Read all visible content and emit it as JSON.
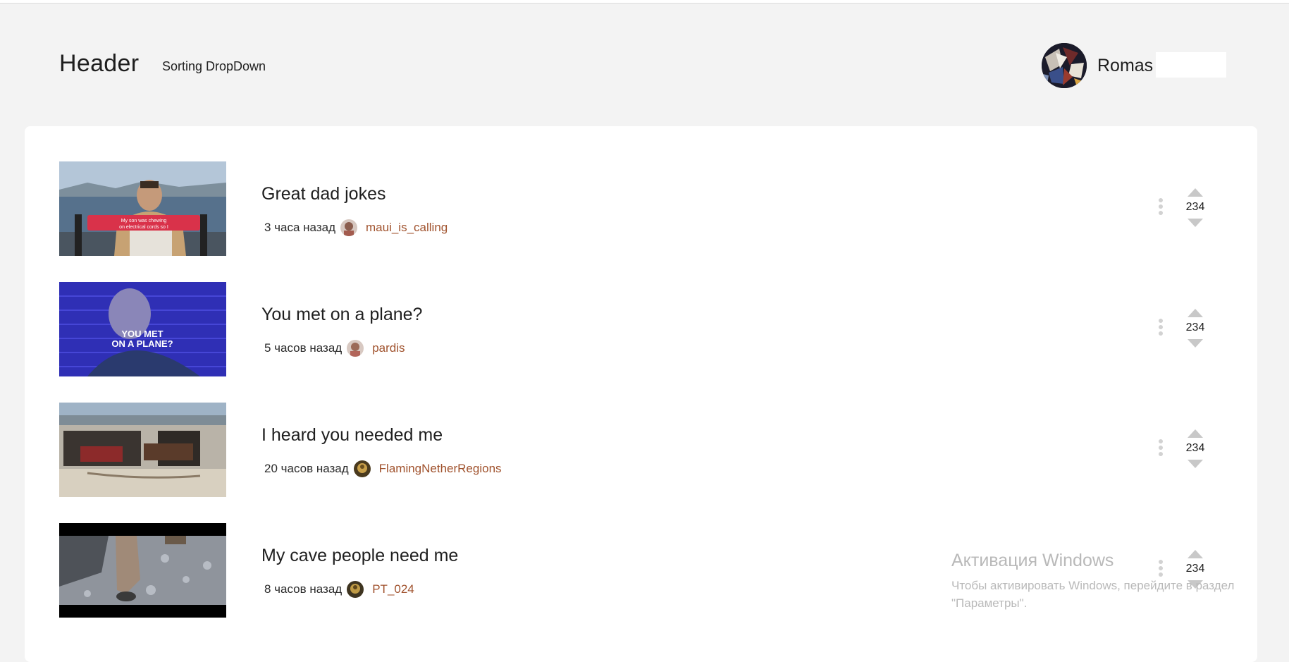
{
  "header": {
    "title": "Header",
    "sorting_label": "Sorting DropDown",
    "user": {
      "name": "Romas"
    }
  },
  "posts": [
    {
      "title": "Great dad jokes",
      "time": "3 часа назад",
      "author": "maui_is_calling",
      "votes": "234",
      "thumb_caption": "My son was chewing on electrical cords so I had to ground him"
    },
    {
      "title": "You met on a plane?",
      "time": "5 часов назад",
      "author": "pardis",
      "votes": "234",
      "thumb_caption": "YOU MET ON A PLANE?"
    },
    {
      "title": "I heard you needed me",
      "time": "20 часов назад",
      "author": "FlamingNetherRegions",
      "votes": "234"
    },
    {
      "title": "My cave people need me",
      "time": "8 часов назад",
      "author": "PT_024",
      "votes": "234"
    }
  ],
  "watermark": {
    "title": "Активация Windows",
    "line1": "Чтобы активировать Windows, перейдите в раздел",
    "line2": "\"Параметры\"."
  },
  "colors": {
    "author_link": "#a0522d",
    "background": "#f3f3f3",
    "panel": "#ffffff",
    "vote_arrow": "#c8c8c8"
  },
  "icons": [
    "kebab-menu-icon",
    "upvote-arrow-icon",
    "downvote-arrow-icon"
  ]
}
